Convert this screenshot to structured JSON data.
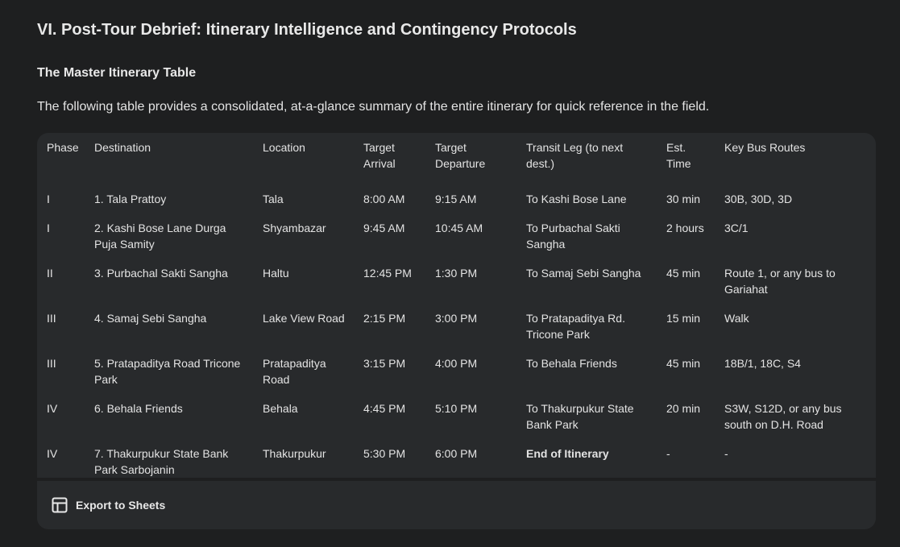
{
  "section_title": "VI. Post-Tour Debrief: Itinerary Intelligence and Contingency Protocols",
  "subsection_title": "The Master Itinerary Table",
  "intro_text": "The following table provides a consolidated, at-a-glance summary of the entire itinerary for quick reference in the field.",
  "table": {
    "headers": [
      "Phase",
      "Destination",
      "Location",
      "Target Arrival",
      "Target Departure",
      "Transit Leg (to next dest.)",
      "Est. Time",
      "Key Bus Routes"
    ],
    "rows": [
      [
        "I",
        "1. Tala Prattoy",
        "Tala",
        "8:00 AM",
        "9:15 AM",
        "To Kashi Bose Lane",
        "30 min",
        "30B, 30D, 3D"
      ],
      [
        "I",
        "2. Kashi Bose Lane Durga Puja Samity",
        "Shyambazar",
        "9:45 AM",
        "10:45 AM",
        "To Purbachal Sakti Sangha",
        "2 hours",
        "3C/1"
      ],
      [
        "II",
        "3. Purbachal Sakti Sangha",
        "Haltu",
        "12:45 PM",
        "1:30 PM",
        "To Samaj Sebi Sangha",
        "45 min",
        "Route 1, or any bus to Gariahat"
      ],
      [
        "III",
        "4. Samaj Sebi Sangha",
        "Lake View Road",
        "2:15 PM",
        "3:00 PM",
        "To Pratapaditya Rd. Tricone Park",
        "15 min",
        "Walk"
      ],
      [
        "III",
        "5. Pratapaditya Road Tricone Park",
        "Pratapaditya Road",
        "3:15 PM",
        "4:00 PM",
        "To Behala Friends",
        "45 min",
        "18B/1, 18C, S4"
      ],
      [
        "IV",
        "6. Behala Friends",
        "Behala",
        "4:45 PM",
        "5:10 PM",
        "To Thakurpukur State Bank Park",
        "20 min",
        "S3W, S12D, or any bus south on D.H. Road"
      ],
      [
        "IV",
        "7. Thakurpukur State Bank Park Sarbojanin",
        "Thakurpukur",
        "5:30 PM",
        "6:00 PM",
        "End of Itinerary",
        "-",
        "-"
      ]
    ],
    "bold_cells": [
      [
        6,
        5
      ]
    ]
  },
  "footer": {
    "export_label": "Export to Sheets",
    "export_icon": "table-icon"
  }
}
